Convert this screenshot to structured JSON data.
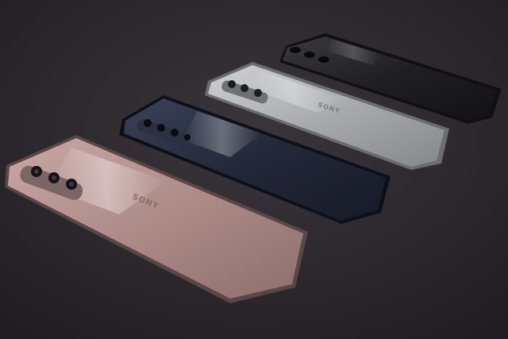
{
  "photo": {
    "subject": "four-smartphones-rear-view",
    "background_color": "#2b272d",
    "phones": [
      {
        "id": "pink",
        "body_color": "#b2918f",
        "brand_text": "SONY"
      },
      {
        "id": "navy",
        "body_color": "#23283b",
        "brand_text": ""
      },
      {
        "id": "silver",
        "body_color": "#a7a9ab",
        "brand_text": "SONY"
      },
      {
        "id": "black",
        "body_color": "#1d1d20",
        "brand_text": ""
      }
    ]
  }
}
